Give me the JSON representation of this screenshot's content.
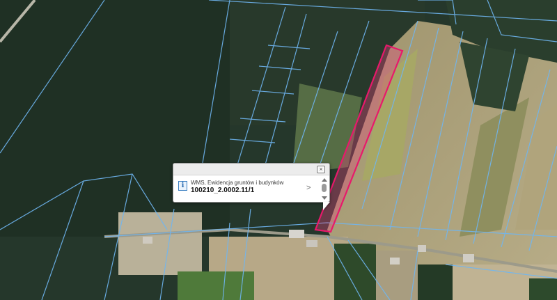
{
  "popup": {
    "close_symbol": "×",
    "info_symbol": "i",
    "layer_name": "WMS, Ewidencja gruntów i budynków",
    "parcel_id": "100210_2.0002.11/1",
    "next_symbol": ">"
  },
  "colors": {
    "forest": "#24362a",
    "field_light": "#a89a72",
    "parcel_line": "#6fb6f2",
    "highlight_stroke": "#e8196b",
    "highlight_fill": "#e8437f"
  },
  "icons": [
    "close-icon",
    "info-icon",
    "chevron-right-icon",
    "scroll-up-icon",
    "scroll-down-icon"
  ]
}
